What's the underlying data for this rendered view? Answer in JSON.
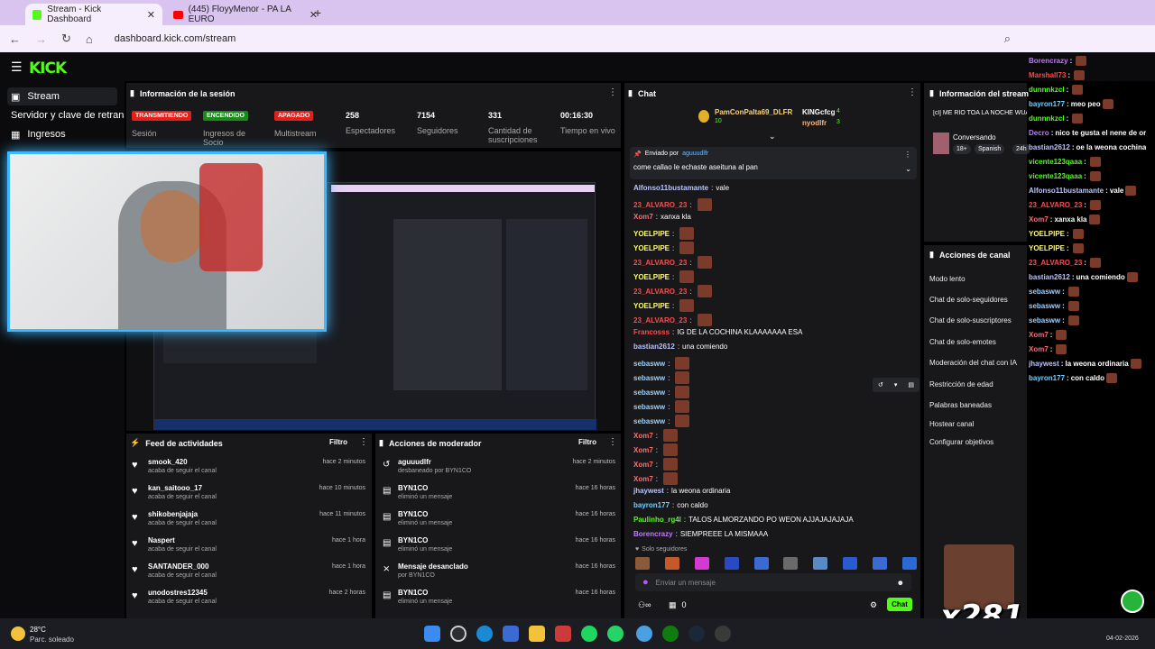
{
  "browser": {
    "tabs": [
      {
        "title": "Stream - Kick Dashboard",
        "active": true
      },
      {
        "title": "(445) FloyyMenor - PA LA EURO",
        "active": false
      }
    ],
    "url": "dashboard.kick.com/stream"
  },
  "sidebar": {
    "items": [
      {
        "label": "Stream",
        "icon": "video-icon"
      },
      {
        "label": "Servidor y clave de retransmisión",
        "icon": "key-icon"
      },
      {
        "label": "Ingresos",
        "icon": "money-icon"
      }
    ]
  },
  "session": {
    "title": "Información de la sesión",
    "badges": [
      {
        "text": "TRANSMITIENDO",
        "label": "Sesión",
        "color": "#e0201a"
      },
      {
        "text": "ENCENDIDO",
        "label": "Ingresos de Socio",
        "color": "#1a8a1a"
      },
      {
        "text": "APAGADO",
        "label": "Multistream",
        "color": "#e0201a"
      }
    ],
    "stats": [
      {
        "value": "258",
        "label": "Espectadores"
      },
      {
        "value": "7154",
        "label": "Seguidores"
      },
      {
        "value": "331",
        "label": "Cantidad de suscripciones"
      },
      {
        "value": "00:16:30",
        "label": "Tiempo en vivo"
      }
    ]
  },
  "chat": {
    "title": "Chat",
    "top_users": [
      {
        "name": "PamConPalta69_DLFR",
        "count": "10"
      },
      {
        "name": "KINGcfcg",
        "count": "4"
      },
      {
        "name": "nyodlfr",
        "count": "3"
      }
    ],
    "pinned": {
      "by_label": "Enviado por",
      "user": "aguuudlfr",
      "message": "come callao le echaste aseituna al pan"
    },
    "messages": [
      {
        "user": "Alfonso11bustamante",
        "text": "vale",
        "color": "#b9c4ff"
      },
      {
        "user": "23_ALVARO_23",
        "text": "",
        "color": "#ff4b4b",
        "emote": true
      },
      {
        "user": "Xom7",
        "text": "xanxa kla",
        "color": "#ff6e6e"
      },
      {
        "user": "YOELPIPE",
        "text": "",
        "color": "#fffb7a",
        "emote": true
      },
      {
        "user": "YOELPIPE",
        "text": "",
        "color": "#fffb7a",
        "emote": true
      },
      {
        "user": "23_ALVARO_23",
        "text": "",
        "color": "#ff4b4b",
        "emote": true
      },
      {
        "user": "YOELPIPE",
        "text": "",
        "color": "#fffb7a",
        "emote": true
      },
      {
        "user": "23_ALVARO_23",
        "text": "",
        "color": "#ff4b4b",
        "emote": true
      },
      {
        "user": "YOELPIPE",
        "text": "",
        "color": "#fffb7a",
        "emote": true
      },
      {
        "user": "23_ALVARO_23",
        "text": "",
        "color": "#ff4b4b",
        "emote": true
      },
      {
        "user": "Francosss",
        "text": "IG DE LA COCHINA KLAAAAAAA ESA",
        "color": "#ff4b4b"
      },
      {
        "user": "bastian2612",
        "text": "una comiendo",
        "color": "#b9c4ff"
      },
      {
        "user": "sebasww",
        "text": "",
        "color": "#9ad0ff",
        "emote": true
      },
      {
        "user": "sebasww",
        "text": "",
        "color": "#9ad0ff",
        "emote": true
      },
      {
        "user": "sebasww",
        "text": "",
        "color": "#9ad0ff",
        "emote": true
      },
      {
        "user": "sebasww",
        "text": "",
        "color": "#9ad0ff",
        "emote": true
      },
      {
        "user": "sebasww",
        "text": "",
        "color": "#9ad0ff",
        "emote": true
      },
      {
        "user": "Xom7",
        "text": "",
        "color": "#ff6e6e",
        "emote": true
      },
      {
        "user": "Xom7",
        "text": "",
        "color": "#ff6e6e",
        "emote": true
      },
      {
        "user": "Xom7",
        "text": "",
        "color": "#ff6e6e",
        "emote": true
      },
      {
        "user": "Xom7",
        "text": "",
        "color": "#ff6e6e",
        "emote": true
      },
      {
        "user": "jhaywest",
        "text": "la weona ordinaria",
        "color": "#b9c4ff"
      },
      {
        "user": "bayron177",
        "text": "con caldo",
        "color": "#6fd3ff"
      },
      {
        "user": "Paulinho_rg4l",
        "text": "TALOS ALMORZANDO PO WEON AJJAJAJAJAJA",
        "color": "#53fc18"
      },
      {
        "user": "Borencrazy",
        "text": "SIEMPREEE LA MISMAAA",
        "color": "#c07bff"
      }
    ],
    "mode": "Solo seguidores",
    "input_placeholder": "Enviar un mensaje",
    "count": "0",
    "send_label": "Chat"
  },
  "stream_info": {
    "title": "Información del stream",
    "stream_title": "[cl] ME RIO TOA LA NOCHE WUAJAJAJAJA Hg !casino !ds",
    "category": "Conversando",
    "tags": [
      "18+",
      "Spanish",
      "24h"
    ]
  },
  "channel_actions": {
    "title": "Acciones de canal",
    "items": [
      "Modo lento",
      "Chat de solo-seguidores",
      "Chat de solo-suscriptores",
      "Chat de solo-emotes",
      "Moderación del chat con IA",
      "Restricción de edad",
      "Palabras baneadas",
      "Hostear canal",
      "Configurar objetivos"
    ]
  },
  "activity_feed": {
    "title": "Feed de actividades",
    "filter": "Filtro",
    "items": [
      {
        "name": "smook_420",
        "sub": "acaba de seguir el canal",
        "time": "hace 2 minutos"
      },
      {
        "name": "kan_saitooo_17",
        "sub": "acaba de seguir el canal",
        "time": "hace 10 minutos"
      },
      {
        "name": "shikobenjajaja",
        "sub": "acaba de seguir el canal",
        "time": "hace 11 minutos"
      },
      {
        "name": "Naspert",
        "sub": "acaba de seguir el canal",
        "time": "hace 1 hora"
      },
      {
        "name": "SANTANDER_000",
        "sub": "acaba de seguir el canal",
        "time": "hace 1 hora"
      },
      {
        "name": "unodostres12345",
        "sub": "acaba de seguir el canal",
        "time": "hace 2 horas"
      }
    ]
  },
  "mod_actions": {
    "title": "Acciones de moderador",
    "filter": "Filtro",
    "items": [
      {
        "name": "aguuudlfr",
        "sub": "desbaneado por BYN1CO",
        "time": "hace 2 minutos",
        "icon": "undo-icon"
      },
      {
        "name": "BYN1CO",
        "sub": "eliminó un mensaje",
        "time": "hace 16 horas",
        "icon": "trash-icon"
      },
      {
        "name": "BYN1CO",
        "sub": "eliminó un mensaje",
        "time": "hace 16 horas",
        "icon": "trash-icon"
      },
      {
        "name": "BYN1CO",
        "sub": "eliminó un mensaje",
        "time": "hace 16 horas",
        "icon": "trash-icon"
      },
      {
        "name": "Mensaje desanclado",
        "sub": "por BYN1CO",
        "time": "hace 16 horas",
        "icon": "unpin-icon"
      },
      {
        "name": "BYN1CO",
        "sub": "eliminó un mensaje",
        "time": "hace 16 horas",
        "icon": "trash-icon"
      }
    ]
  },
  "overlay_chat": [
    {
      "user": "Borencrazy",
      "text": "",
      "color": "#c07bff"
    },
    {
      "user": "Marshall73",
      "text": "",
      "color": "#ff4b4b"
    },
    {
      "user": "dunnnkzcl",
      "text": "",
      "color": "#53fc18"
    },
    {
      "user": "bayron177",
      "text": "meo peo",
      "color": "#6fd3ff"
    },
    {
      "user": "dunnnkzcl",
      "text": "",
      "color": "#53fc18"
    },
    {
      "user": "Decro",
      "text": "nico te gusta el nene de oro?",
      "color": "#c07bff"
    },
    {
      "user": "bastian2612",
      "text": "oe la weona cochina",
      "color": "#b9c4ff"
    },
    {
      "user": "vicente123qaaa",
      "text": "",
      "color": "#53fc18"
    },
    {
      "user": "vicente123qaaa",
      "text": "",
      "color": "#53fc18"
    },
    {
      "user": "Alfonso11bustamante",
      "text": "vale",
      "color": "#b9c4ff"
    },
    {
      "user": "23_ALVARO_23",
      "text": "",
      "color": "#ff4b4b"
    },
    {
      "user": "Xom7",
      "text": "xanxa kla",
      "color": "#ff6e6e"
    },
    {
      "user": "YOELPIPE",
      "text": "",
      "color": "#fffb7a"
    },
    {
      "user": "YOELPIPE",
      "text": "",
      "color": "#fffb7a"
    },
    {
      "user": "23_ALVARO_23",
      "text": "",
      "color": "#ff4b4b"
    },
    {
      "user": "bastian2612",
      "text": "una comiendo",
      "color": "#b9c4ff"
    },
    {
      "user": "sebasww",
      "text": "",
      "color": "#9ad0ff"
    },
    {
      "user": "sebasww",
      "text": "",
      "color": "#9ad0ff"
    },
    {
      "user": "sebasww",
      "text": "",
      "color": "#9ad0ff"
    },
    {
      "user": "Xom7",
      "text": "",
      "color": "#ff6e6e"
    },
    {
      "user": "Xom7",
      "text": "",
      "color": "#ff6e6e"
    },
    {
      "user": "jhaywest",
      "text": "la weona ordinaria",
      "color": "#b9c4ff"
    },
    {
      "user": "bayron177",
      "text": "con caldo",
      "color": "#6fd3ff"
    }
  ],
  "overlay_text": "x281",
  "taskbar": {
    "weather_temp": "28°C",
    "weather_desc": "Parc. soleado",
    "date": "04-02-2026"
  },
  "colors": {
    "kick_green": "#53fc18",
    "panel": "#18181b",
    "red": "#e0201a"
  }
}
